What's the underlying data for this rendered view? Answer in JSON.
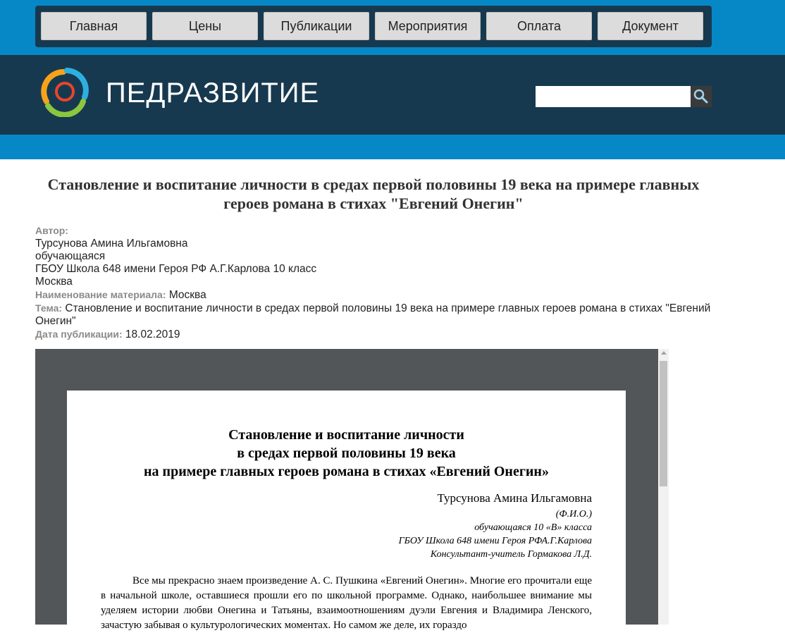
{
  "nav": {
    "items": [
      "Главная",
      "Цены",
      "Публикации",
      "Мероприятия",
      "Оплата",
      "Документ"
    ]
  },
  "header": {
    "logo_text": "ПЕДРАЗВИТИЕ",
    "search_placeholder": ""
  },
  "article": {
    "title": "Становление и воспитание личности в средах первой половины 19 века на примере главных героев романа в стихах \"Евгений Онегин\"",
    "author_label": "Автор:",
    "author_name": "Турсунова Амина Ильгамовна",
    "author_role": "обучающаяся",
    "author_school": "ГБОУ Школа 648 имени Героя РФ А.Г.Карлова 10 класс",
    "author_city": "Москва",
    "material_label": "Наименование материала:",
    "material_value": "Москва",
    "topic_label": "Тема:",
    "topic_value": "Становление и воспитание личности в средах первой половины 19 века на примере главных героев романа в стихах \"Евгений Онегин\"",
    "date_label": "Дата публикации:",
    "date_value": "18.02.2019"
  },
  "document": {
    "title_line1": "Становление и воспитание личности",
    "title_line2": "в средах первой половины 19 века",
    "title_line3": "на примере главных героев романа в стихах «Евгений Онегин»",
    "author": "Турсунова Амина Ильгамовна",
    "fio": "(Ф.И.О.)",
    "grade": "обучающаяся 10 «В» класса",
    "school": "ГБОУ Школа 648 имени Героя РФА.Г.Карлова",
    "consultant": "Консультант-учитель Гормакова Л.Д.",
    "body": "Все мы прекрасно знаем произведение А. С. Пушкина «Евгений Онегин». Многие его прочитали еще в начальной школе, оставшиеся прошли его по школьной программе. Однако, наибольшее внимание мы уделяем истории любви Онегина и Татьяны, взаимоотношениям дуэли Евгения и Владимира Ленского, зачастую забывая о культурологических моментах. Но самом же деле, их гораздо"
  },
  "colors": {
    "nav_bg": "#17394f",
    "accent_blue": "#0788c6",
    "viewer_bg": "#525659"
  }
}
